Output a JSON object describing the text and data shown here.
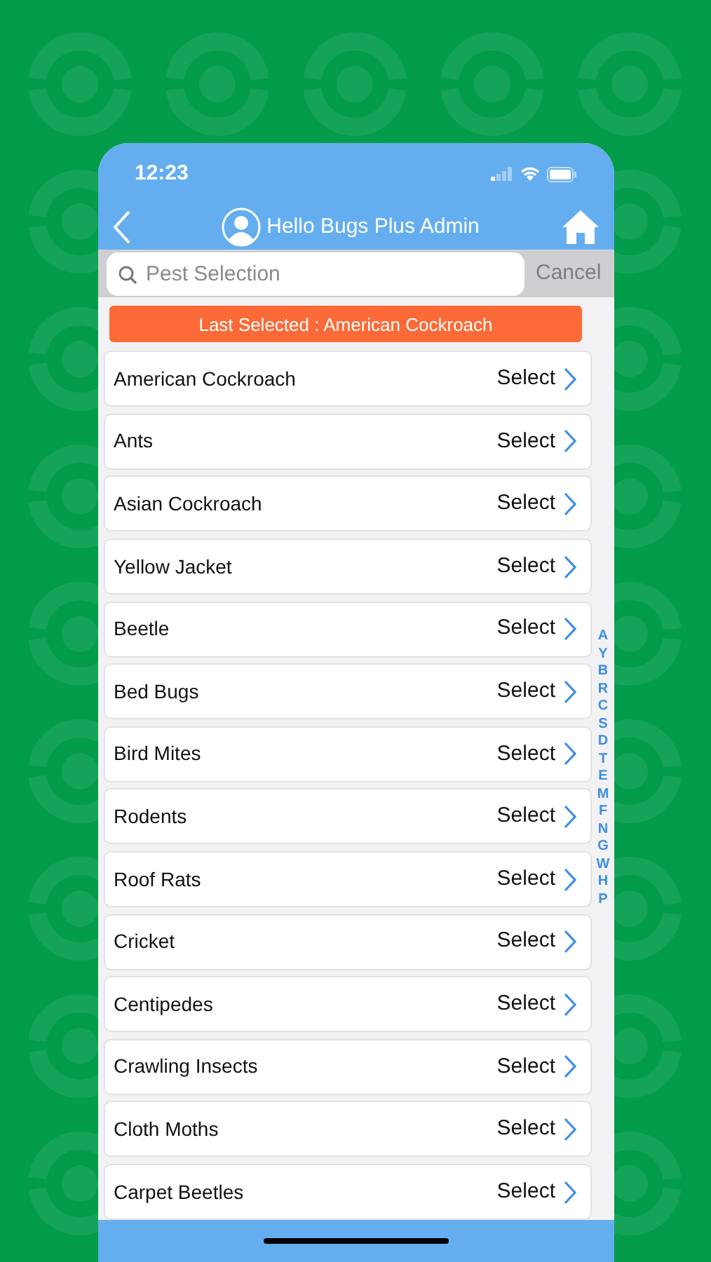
{
  "status_bar": {
    "time": "12:23"
  },
  "header": {
    "title": "Hello Bugs Plus Admin"
  },
  "search": {
    "placeholder": "Pest Selection",
    "cancel": "Cancel"
  },
  "banner": "Last Selected : American Cockroach",
  "pests": [
    {
      "name": "American Cockroach",
      "action": "Select"
    },
    {
      "name": "Ants",
      "action": "Select"
    },
    {
      "name": "Asian Cockroach",
      "action": "Select"
    },
    {
      "name": "Yellow Jacket",
      "action": "Select"
    },
    {
      "name": "Beetle",
      "action": "Select"
    },
    {
      "name": "Bed Bugs",
      "action": "Select"
    },
    {
      "name": "Bird Mites",
      "action": "Select"
    },
    {
      "name": "Rodents",
      "action": "Select"
    },
    {
      "name": "Roof Rats",
      "action": "Select"
    },
    {
      "name": "Cricket",
      "action": "Select"
    },
    {
      "name": "Centipedes",
      "action": "Select"
    },
    {
      "name": "Crawling Insects",
      "action": "Select"
    },
    {
      "name": "Cloth Moths",
      "action": "Select"
    },
    {
      "name": "Carpet Beetles",
      "action": "Select"
    }
  ],
  "index_letters": [
    "A",
    "Y",
    "B",
    "R",
    "C",
    "S",
    "D",
    "T",
    "E",
    "M",
    "F",
    "N",
    "G",
    "W",
    "H",
    "P"
  ]
}
